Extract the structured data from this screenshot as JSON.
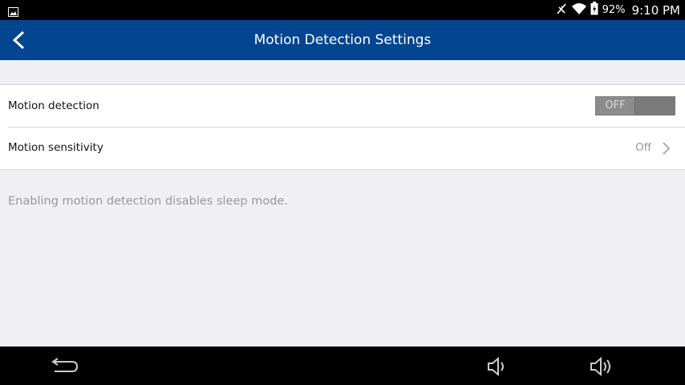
{
  "status_bar": {
    "battery_percent": "92%",
    "time": "9:10 PM",
    "icons": [
      "gallery-icon",
      "signal-off-icon",
      "wifi-icon",
      "battery-charging-icon"
    ]
  },
  "header": {
    "title": "Motion Detection Settings",
    "back_icon": "chevron-left-icon",
    "background": "#034591"
  },
  "settings": {
    "motion_detection": {
      "label": "Motion detection",
      "toggle_text": "OFF",
      "enabled": false
    },
    "motion_sensitivity": {
      "label": "Motion sensitivity",
      "value": "Off"
    }
  },
  "hint": "Enabling motion detection disables sleep mode.",
  "nav_bar": {
    "icons": [
      "back-arrow-icon",
      "volume-down-icon",
      "volume-up-icon"
    ]
  }
}
